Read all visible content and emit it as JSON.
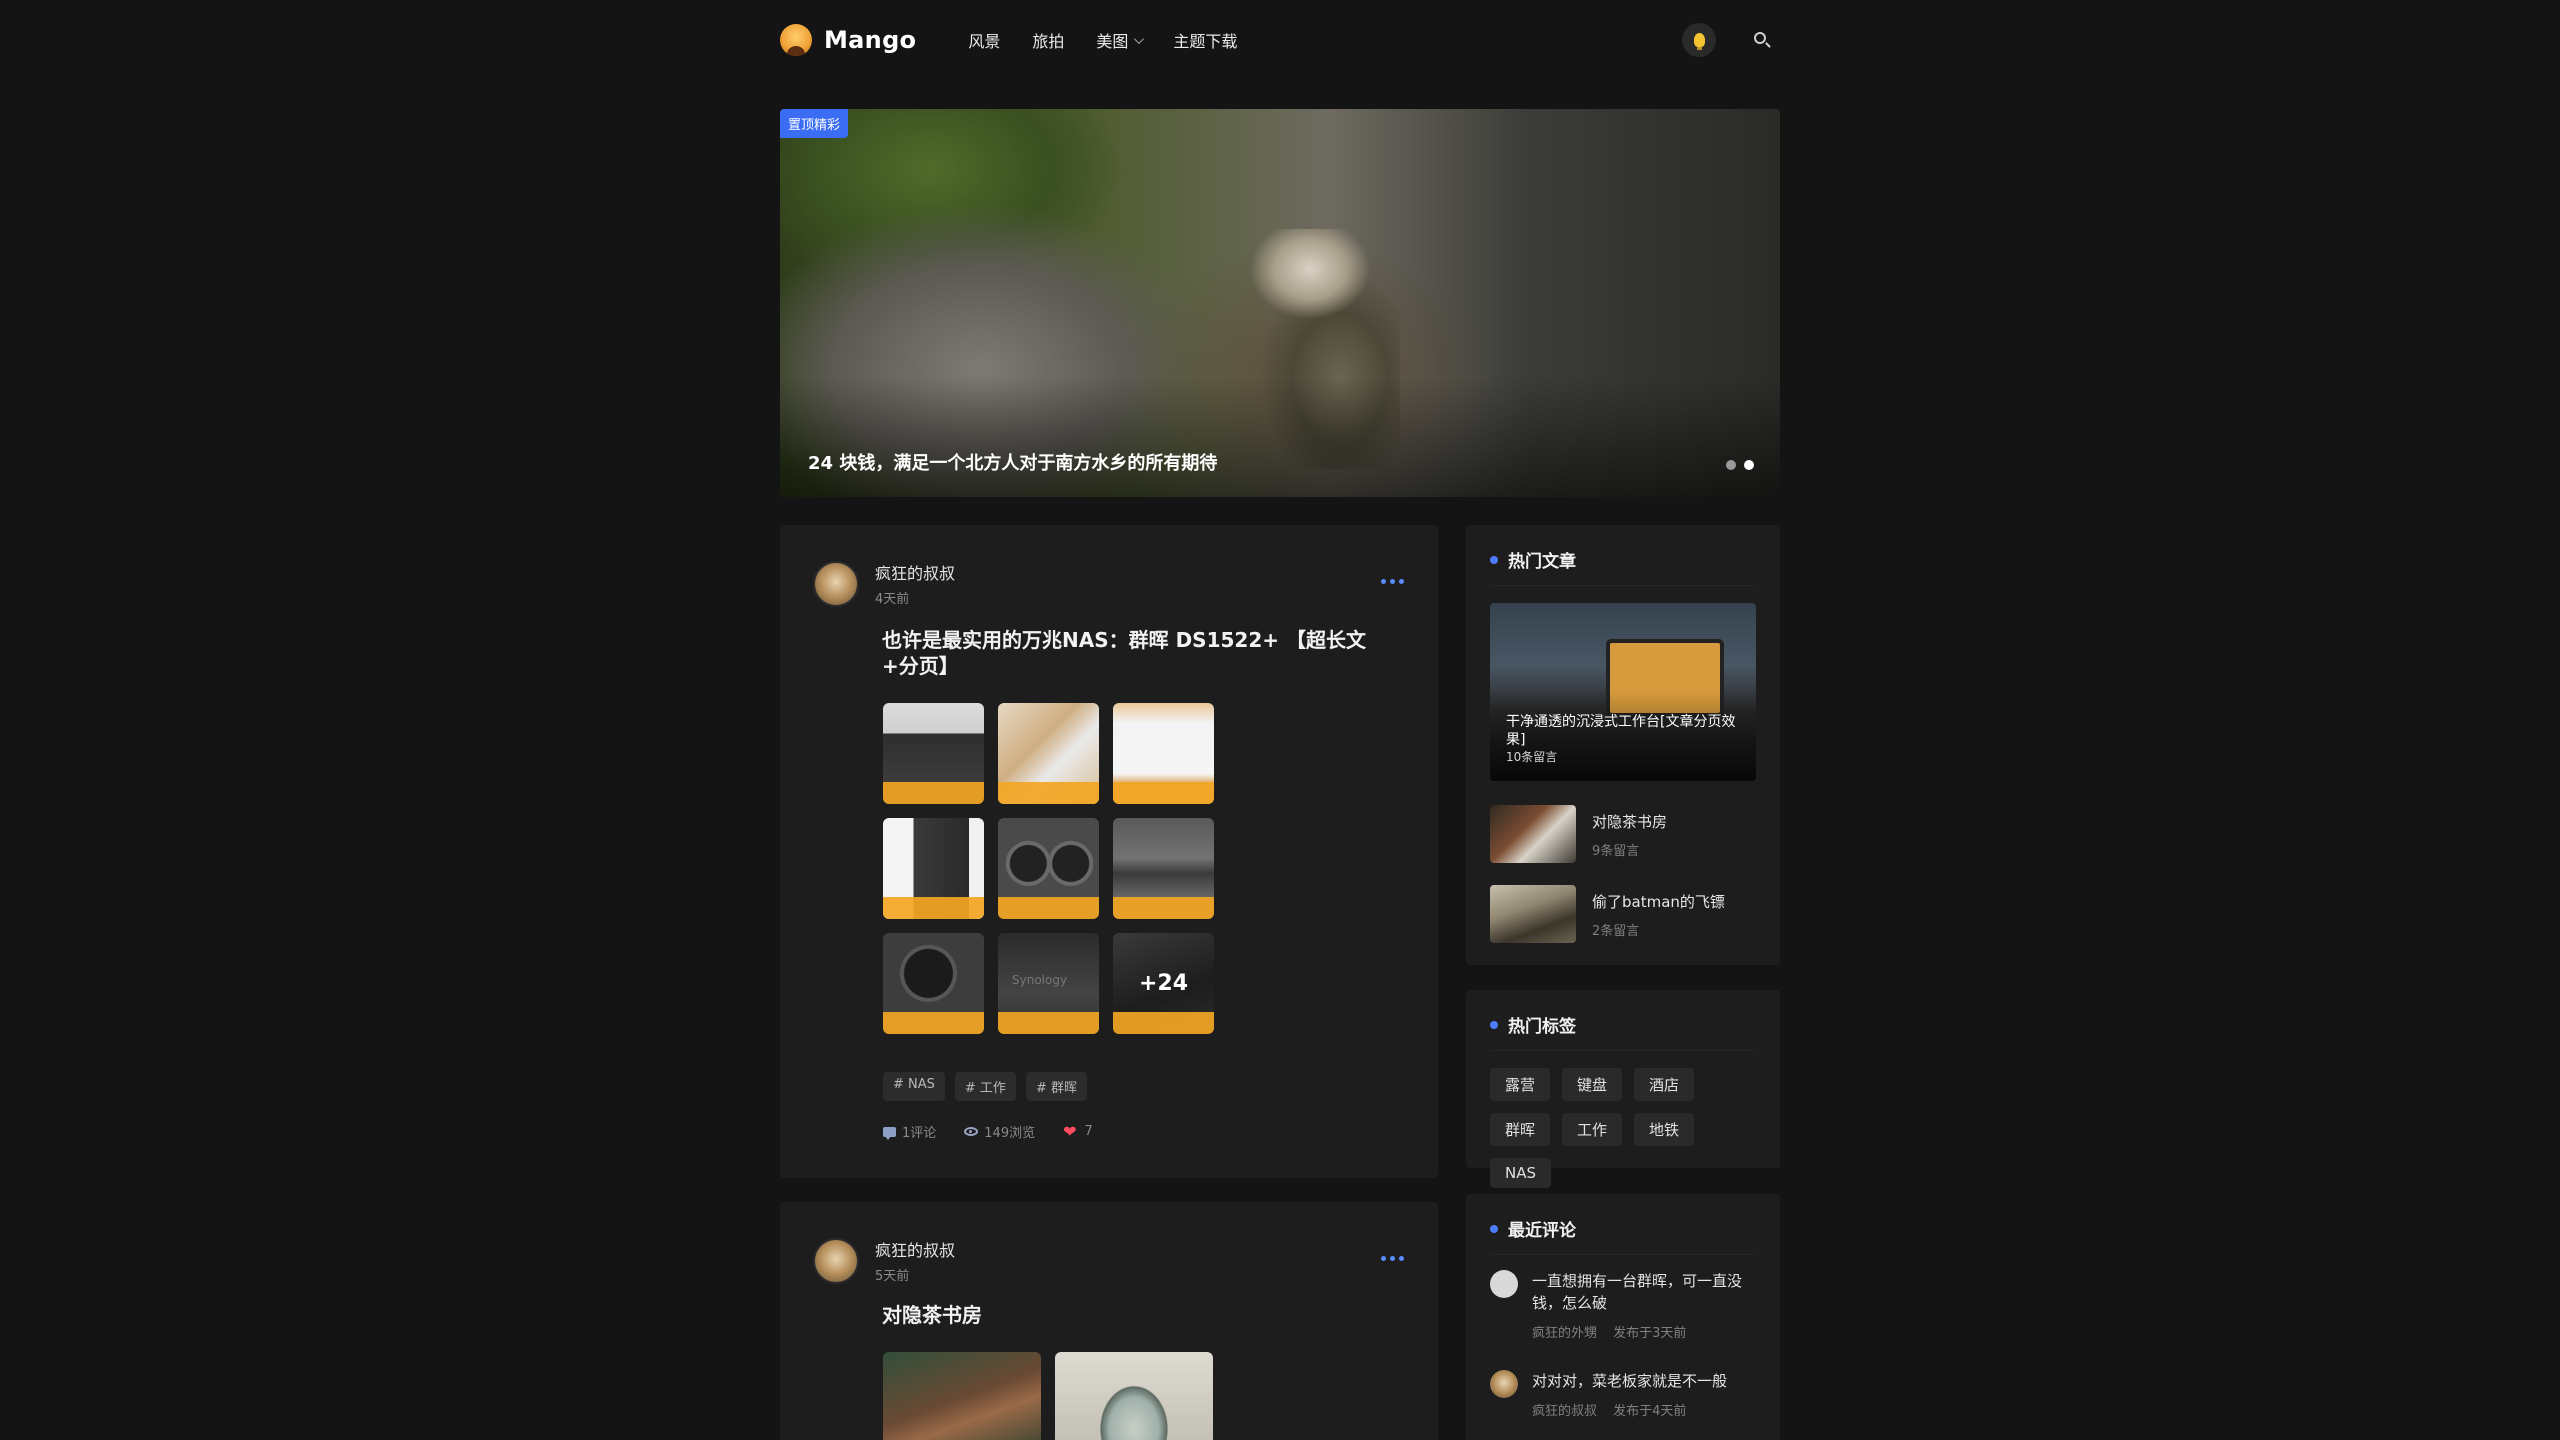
{
  "header": {
    "logo_text": "Mango",
    "nav": [
      "风景",
      "旅拍",
      "美图",
      "主题下载"
    ],
    "icons": [
      "lightbulb-icon",
      "search-icon"
    ]
  },
  "hero": {
    "badge": "置顶精彩",
    "title": "24 块钱，满足一个北方人对于南方水乡的所有期待",
    "slide_count": 2,
    "active_slide": 2
  },
  "posts": [
    {
      "author": "疯狂的叔叔",
      "time": "4天前",
      "title": "也许是最实用的万兆NAS：群晖 DS1522+ 【超长文+分页】",
      "more_images": "+24",
      "tags": [
        "# NAS",
        "# 工作",
        "# 群晖"
      ],
      "comments": "1评论",
      "views": "149浏览",
      "likes": "7"
    },
    {
      "author": "疯狂的叔叔",
      "time": "5天前",
      "title": "对隐茶书房"
    }
  ],
  "sidebar": {
    "hot_articles": {
      "title": "热门文章",
      "featured": {
        "title": "干净通透的沉浸式工作台[文章分页效果]",
        "sub": "10条留言"
      },
      "items": [
        {
          "title": "对隐茶书房",
          "sub": "9条留言"
        },
        {
          "title": "偷了batman的飞镖",
          "sub": "2条留言"
        }
      ]
    },
    "hot_tags": {
      "title": "热门标签",
      "tags": [
        "露营",
        "键盘",
        "酒店",
        "群晖",
        "工作",
        "地铁",
        "NAS"
      ]
    },
    "recent_comments": {
      "title": "最近评论",
      "items": [
        {
          "text": "一直想拥有一台群晖，可一直没钱，怎么破",
          "author": "疯狂的外甥",
          "time": "发布于3天前"
        },
        {
          "text": "对对对，菜老板家就是不一般",
          "author": "疯狂的叔叔",
          "time": "发布于4天前"
        }
      ]
    }
  },
  "colors": {
    "accent": "#3a6cf4",
    "dot": "#4d7dff",
    "heart": "#ff4c5f",
    "background": "#141414",
    "card": "#1d1d1d"
  }
}
